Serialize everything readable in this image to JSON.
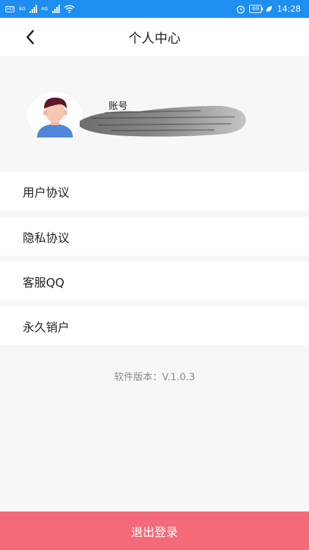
{
  "status_bar": {
    "network_1": "4G",
    "network_2": "4G",
    "hd_tag": "HD",
    "battery": "69",
    "time": "14:28"
  },
  "header": {
    "title": "个人中心"
  },
  "profile": {
    "account_label": "账号"
  },
  "menu": {
    "items": [
      {
        "label": "用户协议"
      },
      {
        "label": "隐私协议"
      },
      {
        "label": "客服QQ"
      },
      {
        "label": "永久销户"
      }
    ]
  },
  "version_text": "软件版本：V.1.0.3",
  "logout_label": "退出登录",
  "colors": {
    "status_bar": "#1f8ef1",
    "logout_button": "#f46a78",
    "background": "#f7f7f7"
  }
}
